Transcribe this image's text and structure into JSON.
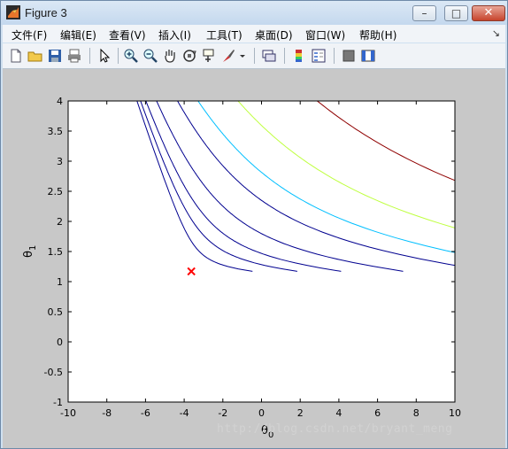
{
  "window": {
    "title": "Figure 3"
  },
  "menu": [
    "文件(F)",
    "编辑(E)",
    "查看(V)",
    "插入(I)",
    "工具(T)",
    "桌面(D)",
    "窗口(W)",
    "帮助(H)"
  ],
  "toolbar_icons": [
    "new-figure-icon",
    "open-file-icon",
    "save-icon",
    "print-icon",
    "pointer-icon",
    "zoom-in-icon",
    "zoom-out-icon",
    "pan-hand-icon",
    "rotate-3d-icon",
    "data-cursor-icon",
    "brush-icon",
    "brush-dropdown-icon",
    "link-plot-icon",
    "colorbar-icon",
    "legend-icon",
    "hide-plot-tools-icon",
    "show-plot-tools-icon"
  ],
  "chart_data": {
    "type": "contour",
    "xlabel": "θ0",
    "ylabel": "θ1",
    "xlim": [
      -10,
      10
    ],
    "ylim": [
      -1,
      4
    ],
    "xticks": [
      "-10",
      "-8",
      "-6",
      "-4",
      "-2",
      "0",
      "2",
      "4",
      "6",
      "8",
      "10"
    ],
    "yticks": [
      "-1",
      "-0.5",
      "0",
      "0.5",
      "1",
      "1.5",
      "2",
      "2.5",
      "3",
      "3.5",
      "4"
    ],
    "marker": {
      "x": -3.63,
      "y": 1.17,
      "symbol": "x",
      "color": "#ff0000"
    },
    "contour_levels": [
      0.5,
      1.5,
      3,
      6,
      12,
      18,
      30,
      55
    ],
    "level_colors": [
      "#00008f",
      "#00008f",
      "#00008f",
      "#00008f",
      "#00008f",
      "#00bfff",
      "#bfff40",
      "#8f0000"
    ]
  },
  "watermark": "http://blog.csdn.net/bryant_meng"
}
